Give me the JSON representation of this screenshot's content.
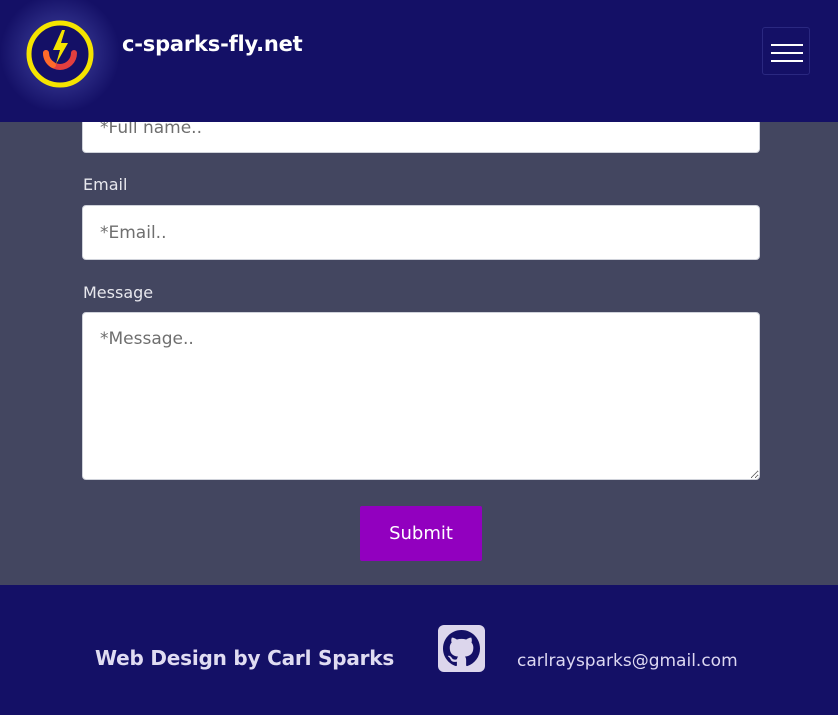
{
  "header": {
    "site_title": "c-sparks-fly.net",
    "logo_icon": "lightning-power-icon",
    "menu_icon": "hamburger-menu-icon"
  },
  "form": {
    "fullname_placeholder": "*Full name..",
    "email_label": "Email",
    "email_placeholder": "*Email..",
    "message_label": "Message",
    "message_placeholder": "*Message..",
    "submit_label": "Submit"
  },
  "footer": {
    "credit": "Web Design by Carl Sparks",
    "github_icon": "github-icon",
    "email": "carlraysparks@gmail.com"
  },
  "colors": {
    "header_bg": "#141066",
    "body_bg": "#434660",
    "submit_bg": "#9200bf",
    "logo_ring": "#f5e400",
    "logo_arc": "#e23f3f"
  }
}
